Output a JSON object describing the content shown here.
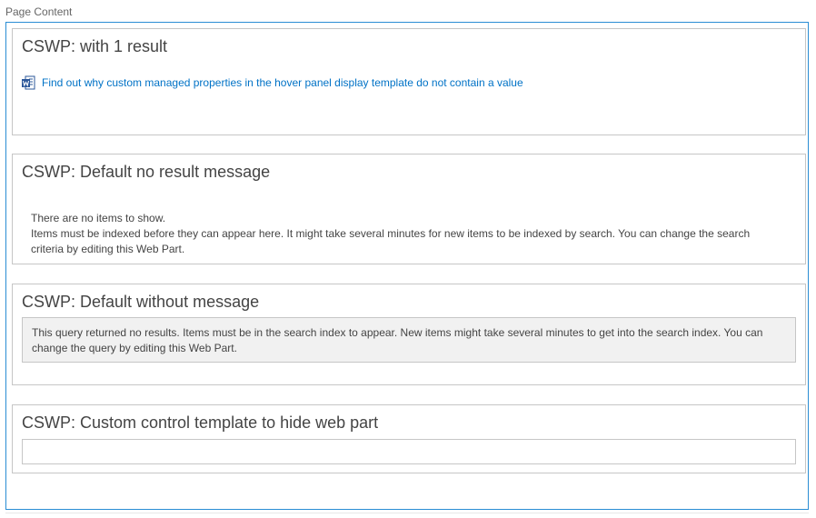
{
  "page": {
    "label": "Page Content"
  },
  "webparts": [
    {
      "title": "CSWP: with 1 result",
      "result": {
        "icon": "word-document-icon",
        "link_text": "Find out why custom managed properties in the hover panel display template do not contain a value"
      }
    },
    {
      "title": "CSWP: Default no result message",
      "line1": "There are no items to show.",
      "line2": "Items must be indexed before they can appear here. It might take several minutes for new items to be indexed by search. You can change the search criteria by editing this Web Part."
    },
    {
      "title": "CSWP: Default without message",
      "message": "This query returned no results. Items must be in the search index to appear. New items might take several minutes to get into the search index. You can change the query by editing this Web Part."
    },
    {
      "title": "CSWP: Custom control template to hide web part"
    }
  ],
  "colors": {
    "accent": "#2a8dd4",
    "link": "#0072c6",
    "word_blue": "#2b579a",
    "border": "#c6c6c6",
    "message_bg": "#f1f1f1"
  }
}
